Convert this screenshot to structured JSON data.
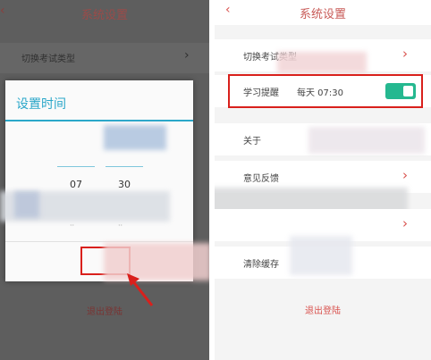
{
  "left": {
    "title": "系统设置",
    "back_icon": "chevron-left-icon",
    "row_exam_type": "切换考试类型",
    "logout": "退出登陆",
    "dialog": {
      "title": "设置时间",
      "hour": "07",
      "minute": "30"
    }
  },
  "right": {
    "title": "系统设置",
    "back_icon": "chevron-left-icon",
    "row_exam_type": "切换考试类型",
    "reminder_label": "学习提醒",
    "reminder_value": "每天 07:30",
    "reminder_enabled": true,
    "row_about": "关于",
    "row_feedback": "意见反馈",
    "row_clear_cache": "清除缓存",
    "logout": "退出登陆"
  },
  "colors": {
    "accent_red": "#d9534f",
    "dialog_blue": "#2aa7c9",
    "toggle_green": "#25b890",
    "highlight_red": "#d9201c"
  }
}
